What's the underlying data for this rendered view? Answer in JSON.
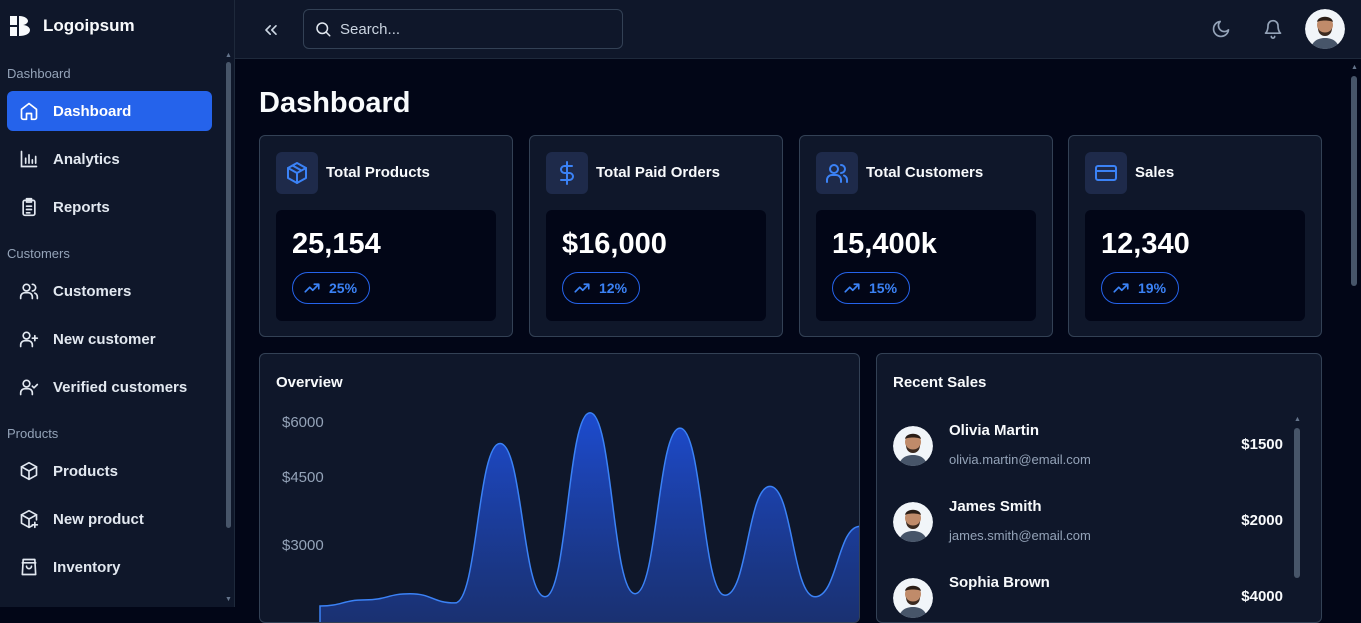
{
  "brand": {
    "name": "Logoipsum"
  },
  "sidebar": {
    "sections": [
      {
        "label": "Dashboard"
      },
      {
        "label": "Customers"
      },
      {
        "label": "Products"
      }
    ],
    "items": [
      {
        "label": "Dashboard",
        "icon": "home-icon"
      },
      {
        "label": "Analytics",
        "icon": "bar-chart-icon"
      },
      {
        "label": "Reports",
        "icon": "clipboard-icon"
      },
      {
        "label": "Customers",
        "icon": "users-icon"
      },
      {
        "label": "New customer",
        "icon": "user-plus-icon"
      },
      {
        "label": "Verified customers",
        "icon": "user-check-icon"
      },
      {
        "label": "Products",
        "icon": "package-icon"
      },
      {
        "label": "New product",
        "icon": "package-plus-icon"
      },
      {
        "label": "Inventory",
        "icon": "shopping-bag-icon"
      }
    ]
  },
  "topbar": {
    "search_placeholder": "Search...",
    "icons": [
      "chevrons-left-icon",
      "moon-icon",
      "bell-icon"
    ]
  },
  "page": {
    "title": "Dashboard"
  },
  "stats": [
    {
      "title": "Total Products",
      "value": "25,154",
      "change": "25%",
      "icon": "box-icon"
    },
    {
      "title": "Total Paid Orders",
      "value": "$16,000",
      "change": "12%",
      "icon": "dollar-icon"
    },
    {
      "title": "Total Customers",
      "value": "15,400k",
      "change": "15%",
      "icon": "users-icon"
    },
    {
      "title": "Sales",
      "value": "12,340",
      "change": "19%",
      "icon": "credit-card-icon"
    }
  ],
  "overview": {
    "title": "Overview",
    "y_ticks": [
      "$6000",
      "$4500",
      "$3000"
    ]
  },
  "chart_data": {
    "type": "area",
    "title": "Overview",
    "ylim": [
      0,
      6500
    ],
    "x": [
      0,
      1,
      2,
      3,
      4,
      5,
      6,
      7,
      8,
      9,
      10,
      11,
      12
    ],
    "values": [
      0,
      200,
      400,
      100,
      5300,
      300,
      6300,
      400,
      5800,
      350,
      3900,
      300,
      2600
    ],
    "color": "#1d4ed8"
  },
  "recent_sales": {
    "title": "Recent Sales",
    "items": [
      {
        "name": "Olivia Martin",
        "email": "olivia.martin@email.com",
        "amount": "$1500"
      },
      {
        "name": "James Smith",
        "email": "james.smith@email.com",
        "amount": "$2000"
      },
      {
        "name": "Sophia Brown",
        "email": "",
        "amount": "$4000"
      }
    ]
  },
  "colors": {
    "accent": "#2563eb",
    "sidebar_bg": "#0f172a",
    "page_bg": "#020617",
    "card_border": "#334155"
  }
}
